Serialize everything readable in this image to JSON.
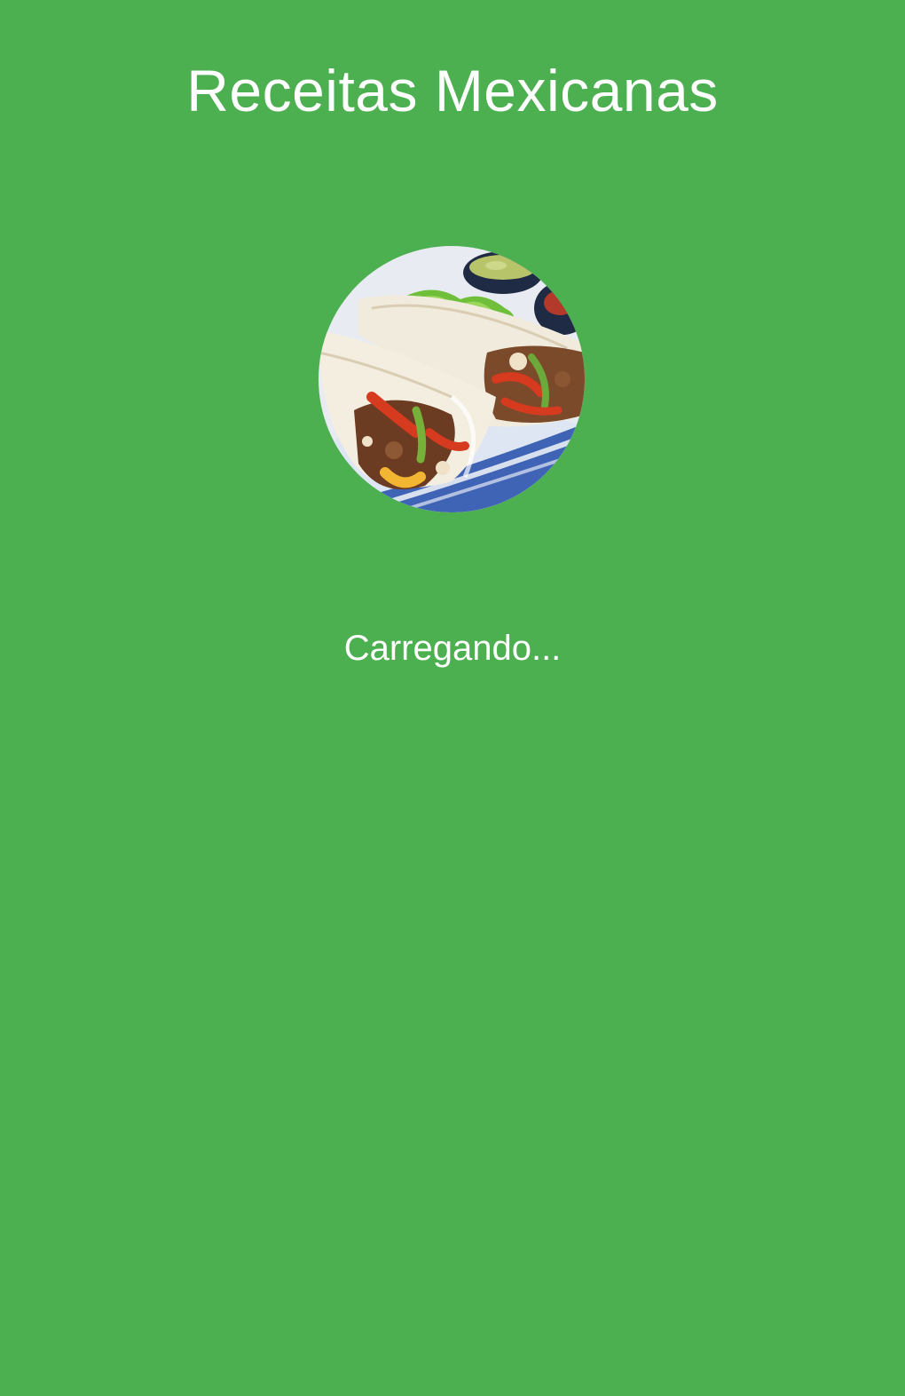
{
  "app": {
    "title": "Receitas Mexicanas",
    "background_color": "#4caf50"
  },
  "splash": {
    "image": "fajita-wraps-photo",
    "status_text": "Carregando..."
  }
}
